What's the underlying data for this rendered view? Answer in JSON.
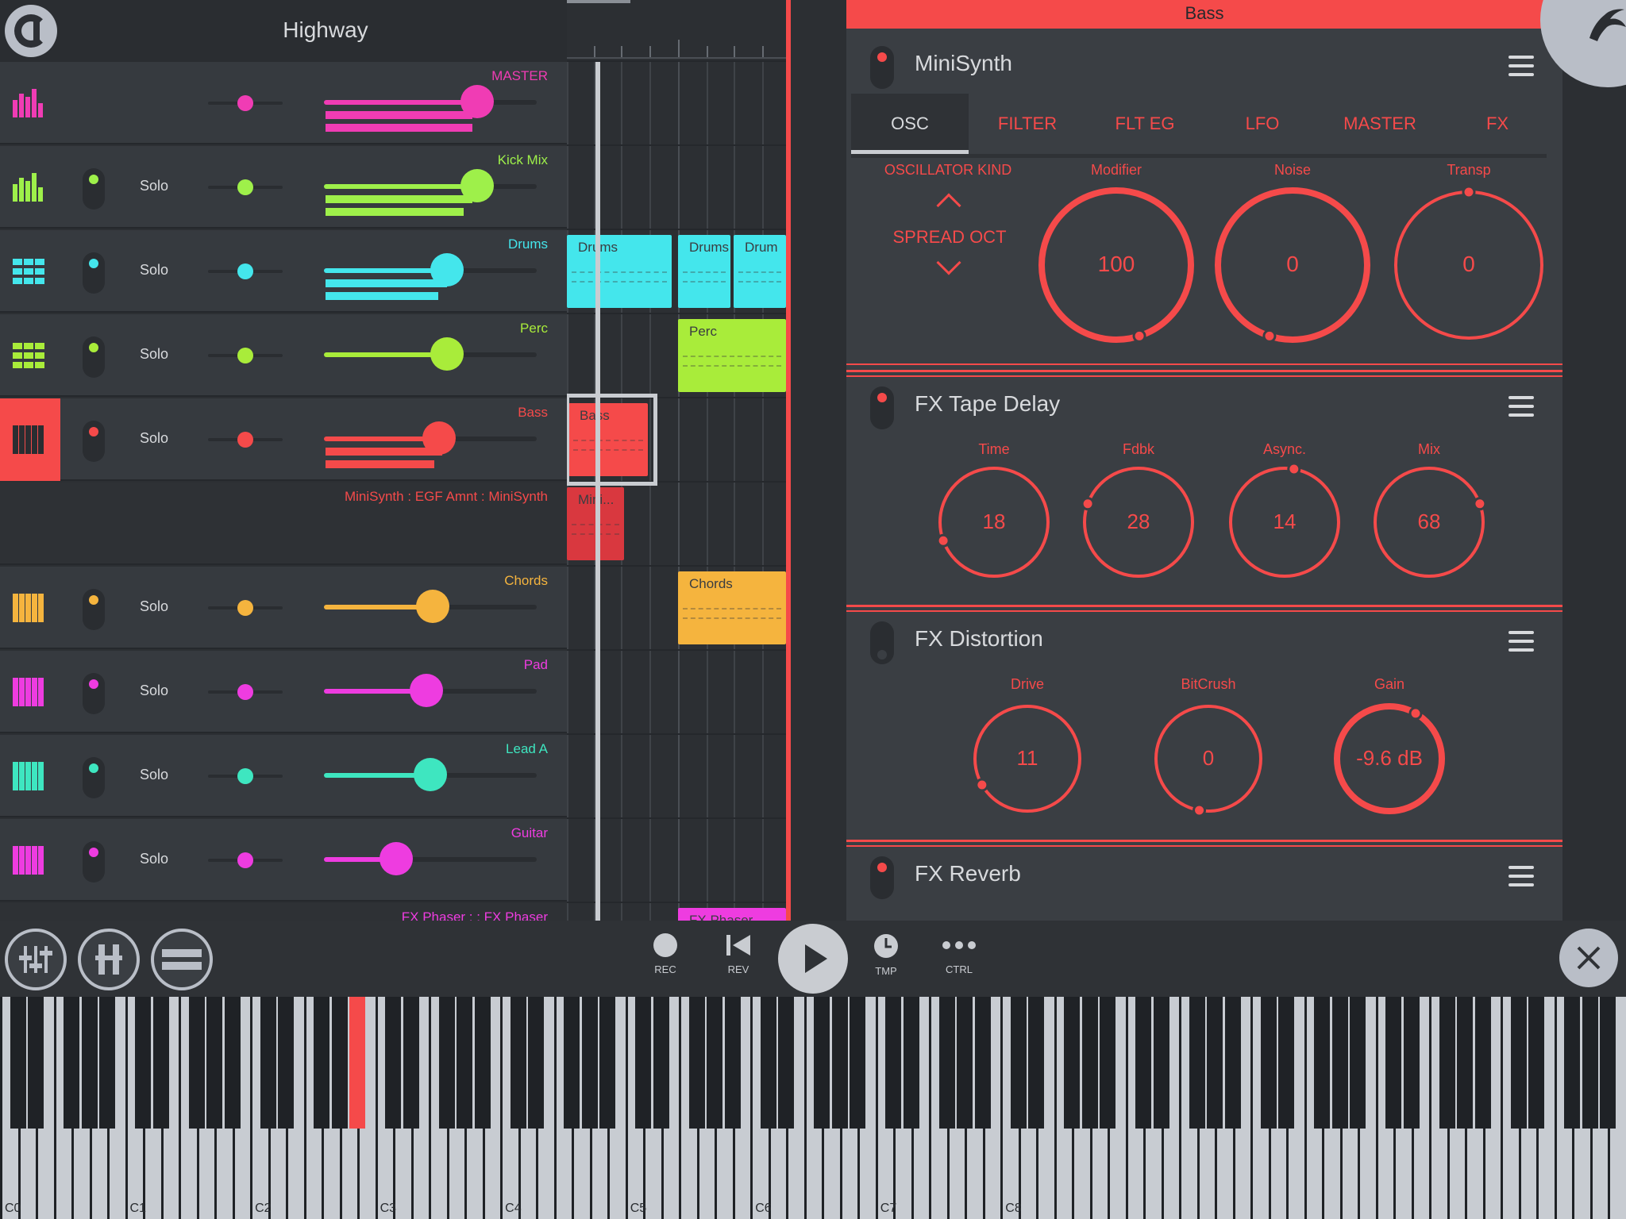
{
  "header": {
    "song_title": "Highway"
  },
  "tracks": [
    {
      "name": "MASTER",
      "color": "#f03cb4",
      "icon": "mixer-bars-icon",
      "solo_label": "",
      "has_mute": false
    },
    {
      "name": "Kick Mix",
      "color": "#9ef04a",
      "icon": "mixer-bars-icon",
      "solo_label": "Solo",
      "has_mute": true
    },
    {
      "name": "Drums",
      "color": "#44e6ec",
      "icon": "drum-pads-icon",
      "solo_label": "Solo",
      "has_mute": true
    },
    {
      "name": "Perc",
      "color": "#a9ec3a",
      "icon": "drum-pads-icon",
      "solo_label": "Solo",
      "has_mute": true
    },
    {
      "name": "Bass",
      "color": "#f54a4a",
      "icon": "piano-keys-icon",
      "solo_label": "Solo",
      "has_mute": true,
      "selected": true
    },
    {
      "name": "MiniSynth : EGF Amnt : MiniSynth",
      "color": "#f54a4a",
      "automation": true
    },
    {
      "name": "Chords",
      "color": "#f5b43e",
      "icon": "piano-keys-icon",
      "solo_label": "Solo",
      "has_mute": true
    },
    {
      "name": "Pad",
      "color": "#ee3ce0",
      "icon": "piano-keys-icon",
      "solo_label": "Solo",
      "has_mute": true
    },
    {
      "name": "Lead A",
      "color": "#3ee6c0",
      "icon": "piano-keys-icon",
      "solo_label": "Solo",
      "has_mute": true
    },
    {
      "name": "Guitar",
      "color": "#ee3ce0",
      "icon": "piano-keys-icon",
      "solo_label": "Solo",
      "has_mute": true
    },
    {
      "name": "FX Phaser :  : FX Phaser",
      "color": "#ee3ce0",
      "automation": true
    }
  ],
  "clips": {
    "drums": [
      "Drums",
      "Drums",
      "Drum"
    ],
    "perc": "Perc",
    "bass": "Bass",
    "mini": "Mini...",
    "chords": "Chords",
    "phaser": "FX Phaser"
  },
  "plugin_panel": {
    "channel_name": "Bass",
    "accent": "#f54a4a",
    "minisynth": {
      "title": "MiniSynth",
      "tabs": [
        "OSC",
        "FILTER",
        "FLT EG",
        "LFO",
        "MASTER",
        "FX"
      ],
      "active_tab": "OSC",
      "osc_kind_label": "OSCILLATOR KIND",
      "osc_kind_value": "SPREAD OCT",
      "knobs": [
        {
          "label": "Modifier",
          "value": "100"
        },
        {
          "label": "Noise",
          "value": "0"
        },
        {
          "label": "Transp",
          "value": "0"
        }
      ]
    },
    "tape_delay": {
      "title": "FX Tape Delay",
      "knobs": [
        {
          "label": "Time",
          "value": "18"
        },
        {
          "label": "Fdbk",
          "value": "28"
        },
        {
          "label": "Async.",
          "value": "14"
        },
        {
          "label": "Mix",
          "value": "68"
        }
      ]
    },
    "distortion": {
      "title": "FX Distortion",
      "knobs": [
        {
          "label": "Drive",
          "value": "11"
        },
        {
          "label": "BitCrush",
          "value": "0"
        },
        {
          "label": "Gain",
          "value": "-9.6 dB"
        }
      ]
    },
    "reverb": {
      "title": "FX Reverb"
    }
  },
  "transport": {
    "rec": "REC",
    "rev": "REV",
    "tmp": "TMP",
    "ctrl": "CTRL"
  },
  "keyboard": {
    "octave_labels": [
      "C0",
      "C1",
      "C2",
      "C3",
      "C4",
      "C5",
      "C6",
      "C7",
      "C8"
    ],
    "highlight_note": "A#2"
  }
}
